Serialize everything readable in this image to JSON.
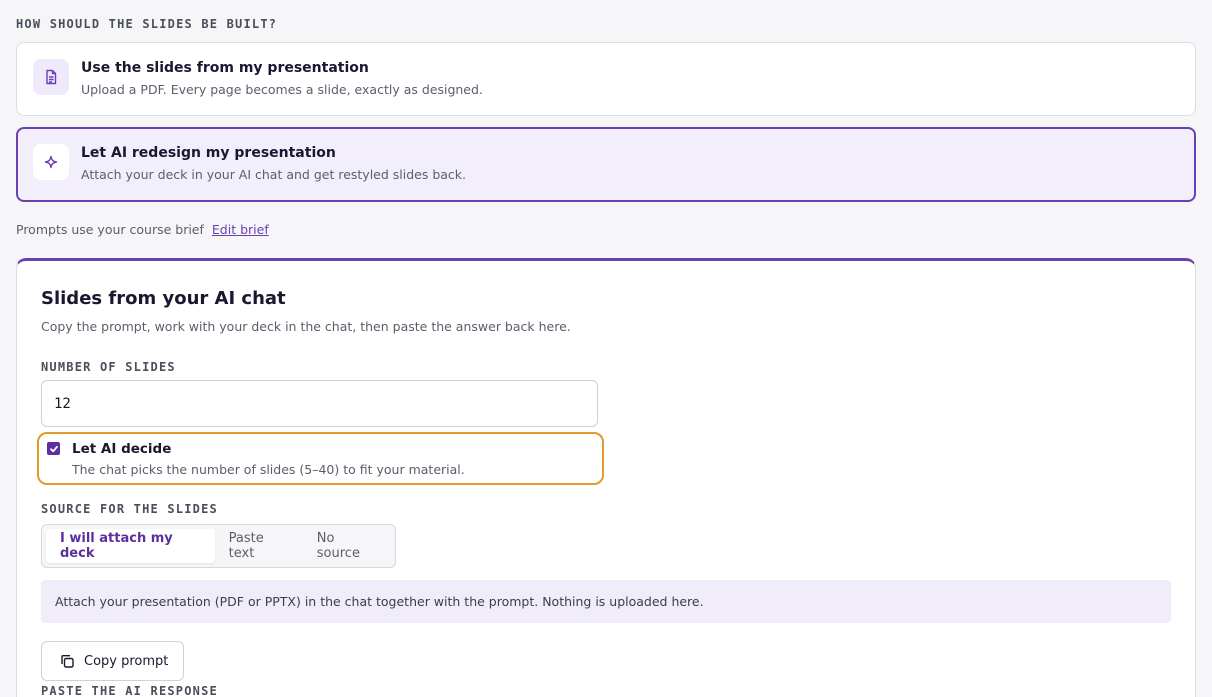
{
  "build": {
    "heading": "HOW SHOULD THE SLIDES BE BUILT?",
    "options": [
      {
        "title": "Use the slides from my presentation",
        "subtitle": "Upload a PDF. Every page becomes a slide, exactly as designed.",
        "icon": "document-icon",
        "selected": false
      },
      {
        "title": "Let AI redesign my presentation",
        "subtitle": "Attach your deck in your AI chat and get restyled slides back.",
        "icon": "sparkle-icon",
        "selected": true
      }
    ]
  },
  "brief": {
    "text": "Prompts use your course brief",
    "link": "Edit brief"
  },
  "panel": {
    "title": "Slides from your AI chat",
    "subtitle": "Copy the prompt, work with your deck in the chat, then paste the answer back here.",
    "num_label": "NUMBER OF SLIDES",
    "num_value": "12",
    "decide_title": "Let AI decide",
    "decide_sub": "The chat picks the number of slides (5–40) to fit your material.",
    "decide_checked": true,
    "source_label": "SOURCE FOR THE SLIDES",
    "source_tabs": [
      "I will attach my deck",
      "Paste text",
      "No source"
    ],
    "source_selected": "I will attach my deck",
    "info": "Attach your presentation (PDF or PPTX) in the chat together with the prompt. Nothing is uploaded here.",
    "copy_label": "Copy prompt",
    "paste_label": "PASTE THE AI RESPONSE"
  },
  "colors": {
    "accent": "#6b3fb3",
    "highlight": "#e39a2a",
    "info_bg": "#f0ecfa"
  }
}
